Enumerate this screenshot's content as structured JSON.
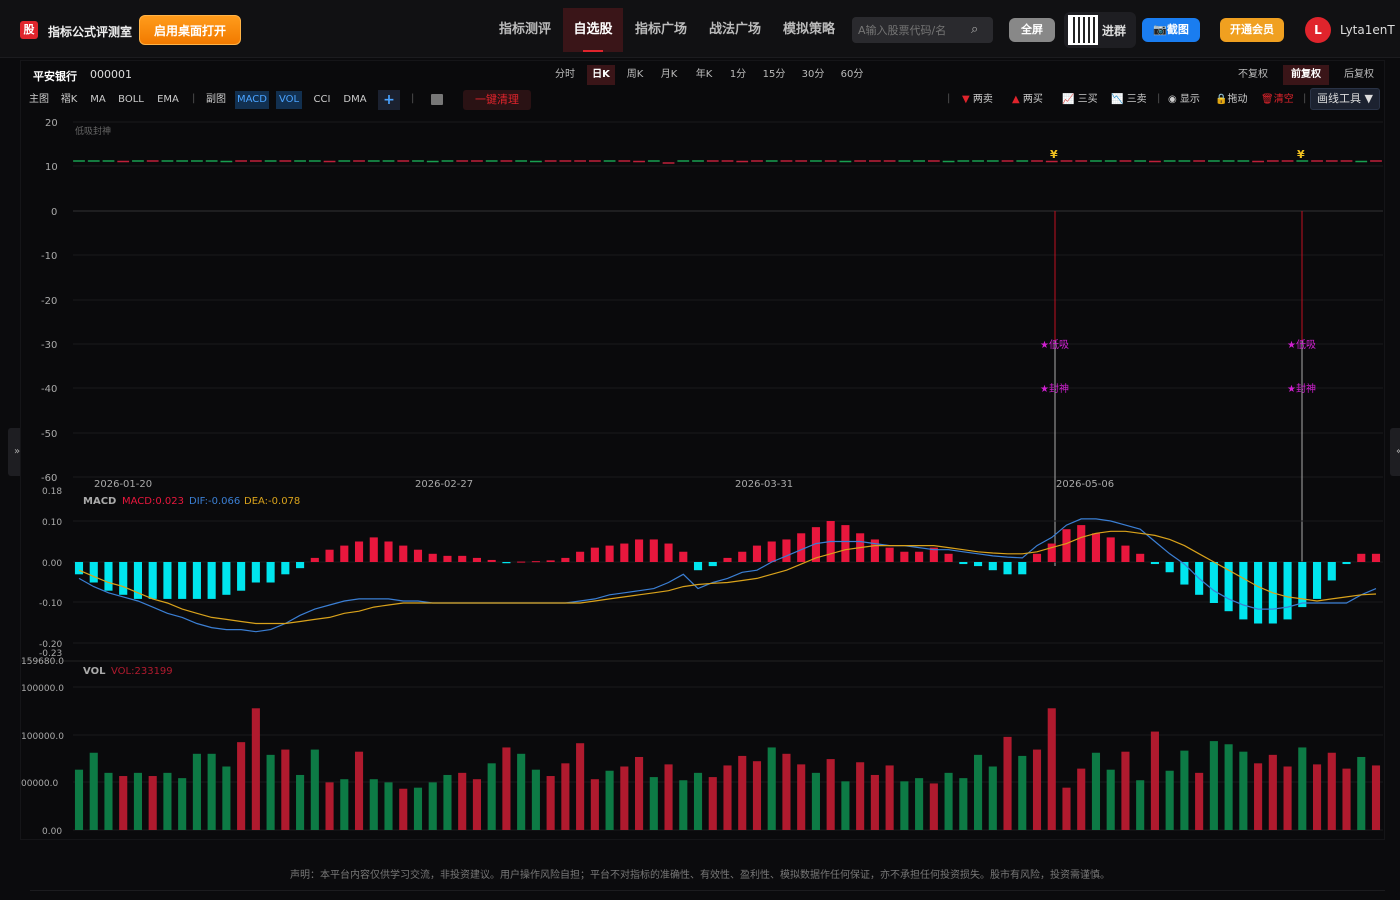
{
  "header": {
    "logo_text": "股",
    "brand": "指标公式评测室",
    "open_desktop": "启用桌面打开",
    "nav": [
      "指标测评",
      "自选股",
      "指标广场",
      "战法广场",
      "模拟策略"
    ],
    "nav_active_index": 1,
    "search_placeholder": "A输入股票代码/名",
    "fullscreen": "全屏",
    "join_group": "进群",
    "screenshot": "截图",
    "vip": "开通会员",
    "avatar_letter": "L",
    "username": "Lyta1enT"
  },
  "stock": {
    "name": "平安银行",
    "code": "000001"
  },
  "periods": [
    "分时",
    "日K",
    "周K",
    "月K",
    "年K",
    "1分",
    "15分",
    "30分",
    "60分"
  ],
  "period_active_index": 1,
  "adjust": [
    "不复权",
    "前复权",
    "后复权"
  ],
  "adjust_active_index": 1,
  "indicator_bar": {
    "main_label": "主图",
    "main_items": [
      "褶K",
      "MA",
      "BOLL",
      "EMA"
    ],
    "sub_label": "副图",
    "sub_items": [
      "MACD",
      "VOL",
      "CCI",
      "DMA"
    ],
    "clear_all": "一键清理"
  },
  "right_tools": [
    "两卖",
    "两买",
    "三买",
    "三卖",
    "显示",
    "拖动",
    "清空"
  ],
  "draw_tools": "画线工具 ▼",
  "main_chart": {
    "indicator_label": "低吸封神",
    "y_ticks": [
      20,
      10,
      0,
      -10,
      -20,
      -30,
      -40,
      -50,
      -60
    ],
    "date_labels": [
      "2026-01-20",
      "2026-02-27",
      "2026-03-31",
      "2026-05-06"
    ],
    "signal_text_1": "★低吸",
    "signal_text_2": "★封神",
    "yen": "¥"
  },
  "macd_panel": {
    "title": "MACD",
    "macd_value": "MACD:0.023",
    "dif_value": "DIF:-0.066",
    "dea_value": "DEA:-0.078",
    "y_ticks": [
      "0.18",
      "0.10",
      "0.00",
      "-0.10",
      "-0.20",
      "-0.23"
    ]
  },
  "vol_panel": {
    "title": "VOL",
    "vol_value": "VOL:233199",
    "y_ticks": [
      "159680.0",
      "100000.0",
      "00000.0",
      "00000.0",
      "0.00"
    ]
  },
  "disclaimer": "声明：本平台内容仅供学习交流，非投资建议。用户操作风险自担；平台不对指标的准确性、有效性、盈利性、模拟数据作任何保证，亦不承担任何投资损失。股市有风险，投资需谨慎。",
  "colors": {
    "up": "#e8173d",
    "down": "#00e5ee",
    "dif": "#3b7fd4",
    "dea": "#d9a21b",
    "vol_up": "#b01a2e",
    "vol_down": "#0d7a45",
    "accent": "#e0242c"
  },
  "chart_data": [
    {
      "type": "bar",
      "name_in_chart": "MACD",
      "x_date_ticks": [
        "2026-01-20",
        "2026-02-27",
        "2026-03-31",
        "2026-05-06"
      ],
      "ylim": [
        -0.23,
        0.18
      ],
      "macd": [
        -0.03,
        -0.05,
        -0.07,
        -0.08,
        -0.09,
        -0.09,
        -0.09,
        -0.09,
        -0.09,
        -0.09,
        -0.08,
        -0.07,
        -0.05,
        -0.05,
        -0.03,
        -0.015,
        0.01,
        0.03,
        0.04,
        0.05,
        0.06,
        0.05,
        0.04,
        0.03,
        0.02,
        0.015,
        0.015,
        0.01,
        0.005,
        -0.003,
        0.001,
        0.002,
        0.004,
        0.01,
        0.025,
        0.035,
        0.04,
        0.045,
        0.055,
        0.055,
        0.045,
        0.025,
        -0.02,
        -0.01,
        0.01,
        0.025,
        0.04,
        0.05,
        0.055,
        0.07,
        0.085,
        0.1,
        0.09,
        0.07,
        0.055,
        0.035,
        0.025,
        0.025,
        0.035,
        0.02,
        -0.005,
        -0.01,
        -0.02,
        -0.03,
        -0.03,
        0.02,
        0.045,
        0.08,
        0.09,
        0.07,
        0.06,
        0.04,
        0.02,
        -0.005,
        -0.025,
        -0.055,
        -0.08,
        -0.1,
        -0.12,
        -0.14,
        -0.15,
        -0.15,
        -0.14,
        -0.11,
        -0.09,
        -0.045,
        -0.005,
        0.02,
        0.02
      ],
      "dif": [
        -0.04,
        -0.06,
        -0.075,
        -0.085,
        -0.095,
        -0.11,
        -0.125,
        -0.135,
        -0.15,
        -0.16,
        -0.165,
        -0.165,
        -0.17,
        -0.165,
        -0.15,
        -0.13,
        -0.115,
        -0.105,
        -0.095,
        -0.09,
        -0.09,
        -0.09,
        -0.095,
        -0.095,
        -0.1,
        -0.1,
        -0.1,
        -0.1,
        -0.1,
        -0.1,
        -0.1,
        -0.1,
        -0.1,
        -0.1,
        -0.095,
        -0.09,
        -0.08,
        -0.075,
        -0.07,
        -0.065,
        -0.05,
        -0.03,
        -0.065,
        -0.05,
        -0.04,
        -0.025,
        -0.02,
        0.0,
        0.015,
        0.03,
        0.045,
        0.05,
        0.05,
        0.05,
        0.045,
        0.04,
        0.04,
        0.035,
        0.03,
        0.03,
        0.025,
        0.02,
        0.015,
        0.012,
        0.01,
        0.04,
        0.06,
        0.09,
        0.105,
        0.105,
        0.1,
        0.09,
        0.08,
        0.05,
        0.02,
        -0.005,
        -0.04,
        -0.07,
        -0.09,
        -0.105,
        -0.115,
        -0.115,
        -0.11,
        -0.1,
        -0.1,
        -0.1,
        -0.1,
        -0.08,
        -0.065
      ],
      "dea": [
        -0.02,
        -0.035,
        -0.05,
        -0.06,
        -0.075,
        -0.09,
        -0.1,
        -0.115,
        -0.125,
        -0.135,
        -0.14,
        -0.145,
        -0.15,
        -0.15,
        -0.15,
        -0.145,
        -0.14,
        -0.135,
        -0.125,
        -0.12,
        -0.11,
        -0.105,
        -0.1,
        -0.1,
        -0.1,
        -0.1,
        -0.1,
        -0.1,
        -0.1,
        -0.1,
        -0.1,
        -0.1,
        -0.1,
        -0.1,
        -0.1,
        -0.095,
        -0.09,
        -0.085,
        -0.08,
        -0.075,
        -0.07,
        -0.06,
        -0.055,
        -0.052,
        -0.05,
        -0.045,
        -0.04,
        -0.03,
        -0.02,
        -0.005,
        0.01,
        0.02,
        0.03,
        0.035,
        0.04,
        0.04,
        0.04,
        0.04,
        0.04,
        0.035,
        0.03,
        0.025,
        0.022,
        0.02,
        0.02,
        0.025,
        0.035,
        0.045,
        0.06,
        0.07,
        0.075,
        0.075,
        0.07,
        0.065,
        0.055,
        0.04,
        0.02,
        0.0,
        -0.02,
        -0.04,
        -0.06,
        -0.075,
        -0.085,
        -0.09,
        -0.095,
        -0.09,
        -0.085,
        -0.08,
        -0.078
      ]
    },
    {
      "type": "bar",
      "name_in_chart": "VOL",
      "ylim": [
        0,
        159680
      ],
      "volumes": [
        57000,
        73000,
        54000,
        51000,
        54000,
        51000,
        54000,
        49000,
        72000,
        72000,
        60000,
        83000,
        115000,
        71000,
        76000,
        52000,
        76000,
        45000,
        48000,
        74000,
        48000,
        45000,
        39000,
        40000,
        45000,
        52000,
        54000,
        48000,
        63000,
        78000,
        72000,
        57000,
        51000,
        63000,
        82000,
        48000,
        56000,
        60000,
        69000,
        50000,
        62000,
        47000,
        54000,
        50000,
        61000,
        70000,
        65000,
        78000,
        72000,
        62000,
        54000,
        67000,
        46000,
        64000,
        52000,
        61000,
        46000,
        49000,
        44000,
        54000,
        49000,
        71000,
        60000,
        88000,
        70000,
        76000,
        115000,
        40000,
        58000,
        73000,
        57000,
        74000,
        47000,
        93000,
        56000,
        75000,
        54000,
        84000,
        81000,
        74000,
        63000,
        71000,
        60000,
        78000,
        62000,
        73000,
        58000,
        69000,
        61000
      ],
      "up": [
        0,
        0,
        0,
        1,
        0,
        1,
        0,
        0,
        0,
        0,
        0,
        1,
        1,
        0,
        1,
        0,
        0,
        1,
        0,
        1,
        0,
        0,
        1,
        0,
        0,
        0,
        1,
        1,
        0,
        1,
        0,
        0,
        1,
        1,
        1,
        1,
        0,
        1,
        1,
        0,
        1,
        0,
        0,
        1,
        1,
        1,
        1,
        0,
        1,
        1,
        0,
        1,
        0,
        1,
        1,
        1,
        0,
        0,
        1,
        0,
        0,
        0,
        0,
        1,
        0,
        1,
        1,
        1,
        1,
        0,
        0,
        1,
        0,
        1,
        0,
        0,
        1,
        0,
        0,
        0,
        1,
        1,
        1,
        0,
        1,
        1,
        1,
        0,
        1
      ]
    }
  ]
}
